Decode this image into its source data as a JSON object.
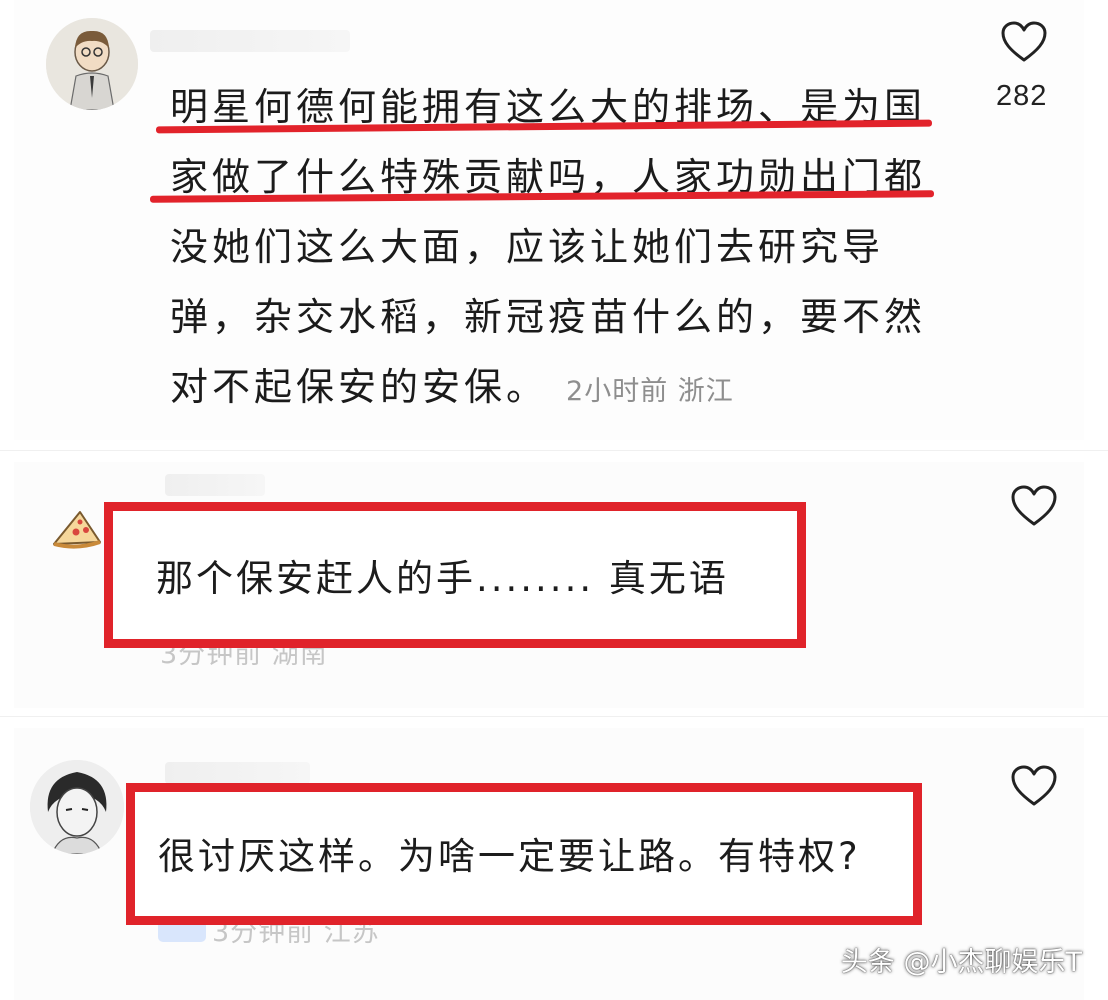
{
  "comments": [
    {
      "text": "明星何德何能拥有这么大的排场、是为国家做了什么特殊贡献吗，人家功勋出门都没她们这么大面，应该让她们去研究导弹，杂交水稻，新冠疫苗什么的，要不然对不起保安的安保。",
      "meta": "2小时前 浙江",
      "likes": "282",
      "avatar_icon": "cartoon-boy-avatar"
    },
    {
      "text": "那个保安赶人的手........ 真无语",
      "avatar_icon": "pizza-avatar",
      "meta_obscured": "3分钟前 湖南"
    },
    {
      "text": "很讨厌这样。为啥一定要让路。有特权?",
      "avatar_icon": "anime-boy-avatar",
      "meta_obscured": "3分钟前 江苏"
    }
  ],
  "icons": {
    "like": "heart-outline-icon"
  },
  "watermark": "头条 @小杰聊娱乐T",
  "colors": {
    "highlight_red": "#e0232a",
    "meta_gray": "#8e8e8e"
  }
}
